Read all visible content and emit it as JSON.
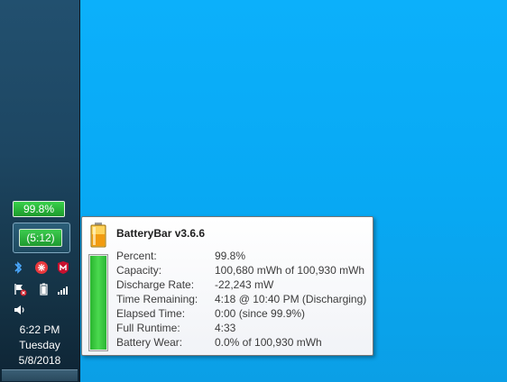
{
  "taskbar": {
    "battery_percent_label": "99.8%",
    "battery_level": 0.998,
    "time_remaining_label": "(5:12)",
    "clock": {
      "time": "6:22 PM",
      "day": "Tuesday",
      "date": "5/8/2018"
    }
  },
  "tooltip": {
    "title": "BatteryBar v3.6.6",
    "bar_level": 0.998,
    "rows": [
      {
        "label": "Percent:",
        "value": "99.8%"
      },
      {
        "label": "Capacity:",
        "value": "100,680 mWh of 100,930 mWh"
      },
      {
        "label": "Discharge Rate:",
        "value": "-22,243 mW"
      },
      {
        "label": "Time Remaining:",
        "value": "4:18 @ 10:40 PM (Discharging)"
      },
      {
        "label": "Elapsed Time:",
        "value": "0:00 (since 99.9%)"
      },
      {
        "label": "Full Runtime:",
        "value": "4:33"
      },
      {
        "label": "Battery Wear:",
        "value": "0.0% of 100,930 mWh"
      }
    ]
  },
  "colors": {
    "desktop": "#0aa4f3",
    "battery_green": "#2db537"
  },
  "icons": [
    "bluetooth-icon",
    "antivirus-icon",
    "mcafee-icon",
    "action-center-flag-icon",
    "power-battery-icon",
    "network-signal-icon",
    "volume-icon"
  ]
}
